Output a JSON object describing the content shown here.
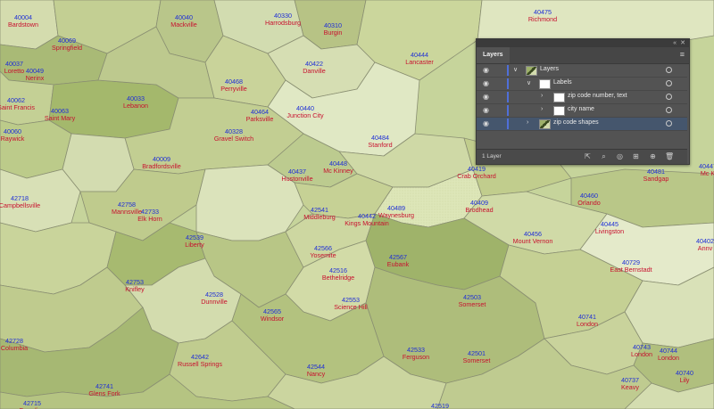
{
  "colors": {
    "zip": "#1f2fd6",
    "city": "#c8102e",
    "panel_bg": "#535353",
    "selected_row": "#45566d",
    "layer_color": "#4f6fd9"
  },
  "map": {
    "labels": [
      {
        "zip": "40004",
        "city": "Bardstown"
      },
      {
        "zip": "40040",
        "city": "Mackville"
      },
      {
        "zip": "40330",
        "city": "Harrodsburg"
      },
      {
        "zip": "40310",
        "city": "Burgin"
      },
      {
        "zip": "40475",
        "city": "Richmond"
      },
      {
        "zip": "40069",
        "city": "Springfield"
      },
      {
        "zip": "40037",
        "city": "Loretto"
      },
      {
        "zip": "40049",
        "city": "Nerinx"
      },
      {
        "zip": "40422",
        "city": "Danville"
      },
      {
        "zip": "40444",
        "city": "Lancaster"
      },
      {
        "zip": "40468",
        "city": "Perryville"
      },
      {
        "zip": "40033",
        "city": "Lebanon"
      },
      {
        "zip": "40062",
        "city": "Saint Francis"
      },
      {
        "zip": "40063",
        "city": "Saint Mary"
      },
      {
        "zip": "40464",
        "city": "Parksville"
      },
      {
        "zip": "40440",
        "city": "Junction City"
      },
      {
        "zip": "40060",
        "city": "Raywick"
      },
      {
        "zip": "40328",
        "city": "Gravel Switch"
      },
      {
        "zip": "40484",
        "city": "Stanford"
      },
      {
        "zip": "40009",
        "city": "Bradfordsville"
      },
      {
        "zip": "40437",
        "city": "Hustonville"
      },
      {
        "zip": "40448",
        "city": "Mc Kinney"
      },
      {
        "zip": "40419",
        "city": "Crab Orchard"
      },
      {
        "zip": "40481",
        "city": "Sandgap"
      },
      {
        "zip": "40447",
        "city": "Mc K"
      },
      {
        "zip": "42718",
        "city": "Campbellsville"
      },
      {
        "zip": "42758",
        "city": "Mannsville"
      },
      {
        "zip": "42733",
        "city": "Elk Horn"
      },
      {
        "zip": "42541",
        "city": "Middleburg"
      },
      {
        "zip": "40442",
        "city": "Kings Mountain"
      },
      {
        "zip": "40489",
        "city": "Waynesburg"
      },
      {
        "zip": "40409",
        "city": "Brodhead"
      },
      {
        "zip": "40460",
        "city": "Orlando"
      },
      {
        "zip": "40445",
        "city": "Livingston"
      },
      {
        "zip": "42539",
        "city": "Liberty"
      },
      {
        "zip": "42566",
        "city": "Yosemite"
      },
      {
        "zip": "40456",
        "city": "Mount Vernon"
      },
      {
        "zip": "40402",
        "city": "Annv"
      },
      {
        "zip": "42567",
        "city": "Eubank"
      },
      {
        "zip": "40729",
        "city": "East Bernstadt"
      },
      {
        "zip": "42516",
        "city": "Bethelridge"
      },
      {
        "zip": "42753",
        "city": "Knifley"
      },
      {
        "zip": "42528",
        "city": "Dunnville"
      },
      {
        "zip": "42553",
        "city": "Science Hill"
      },
      {
        "zip": "42503",
        "city": "Somerset"
      },
      {
        "zip": "42565",
        "city": "Windsor"
      },
      {
        "zip": "40741",
        "city": "London"
      },
      {
        "zip": "42728",
        "city": "Columbia"
      },
      {
        "zip": "42642",
        "city": "Russell Springs"
      },
      {
        "zip": "42533",
        "city": "Ferguson"
      },
      {
        "zip": "42501",
        "city": "Somerset"
      },
      {
        "zip": "40743",
        "city": "London"
      },
      {
        "zip": "40744",
        "city": "London"
      },
      {
        "zip": "42544",
        "city": "Nancy"
      },
      {
        "zip": "40740",
        "city": "Lily"
      },
      {
        "zip": "42741",
        "city": "Glens Fork"
      },
      {
        "zip": "40737",
        "city": "Keavy"
      },
      {
        "zip": "42715",
        "city": "Breeding"
      },
      {
        "zip": "42519",
        "city": ""
      }
    ]
  },
  "panel": {
    "tab": "Layers",
    "layers": [
      {
        "name": "Layers",
        "has_thumb_map": true
      },
      {
        "name": "Labels"
      },
      {
        "name": "zip code number, text"
      },
      {
        "name": "city name"
      },
      {
        "name": "zip code shapes",
        "has_thumb_map": true,
        "selected": true
      }
    ],
    "count": "1 Layer",
    "icons": [
      "export-icon",
      "search-icon",
      "clipping-icon",
      "sublayer-icon",
      "new-layer-icon",
      "trash-icon"
    ]
  }
}
